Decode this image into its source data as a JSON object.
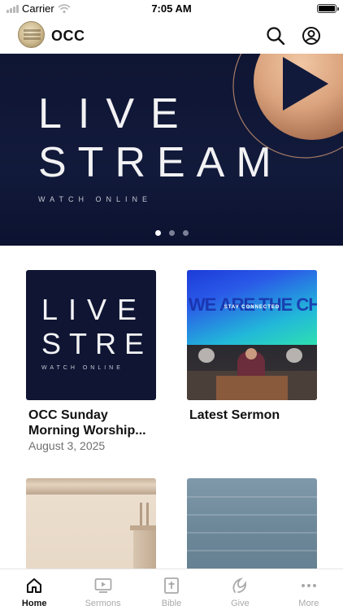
{
  "status_bar": {
    "carrier": "Carrier",
    "time": "7:05 AM"
  },
  "header": {
    "title": "OCC",
    "search_icon": "search-icon",
    "account_icon": "account-icon"
  },
  "hero": {
    "line1": "LIVE",
    "line2": "STREAM",
    "subtitle": "WATCH ONLINE",
    "slide_count": 3,
    "active_slide": 1
  },
  "cards": [
    {
      "thumb_line1": "LIVE",
      "thumb_line2": "STRE",
      "thumb_sub": "WATCH ONLINE",
      "title": "OCC Sunday Morning Worship...",
      "date": "August 3, 2025"
    },
    {
      "thumb_big": "WE ARE THE CHURCH",
      "thumb_small": "STAY CONNECTED",
      "title": "Latest Sermon",
      "date": ""
    },
    {
      "title": "",
      "date": ""
    },
    {
      "title": "",
      "date": ""
    }
  ],
  "tabs": [
    {
      "label": "Home",
      "icon": "home-icon",
      "active": true
    },
    {
      "label": "Sermons",
      "icon": "video-icon",
      "active": false
    },
    {
      "label": "Bible",
      "icon": "bible-icon",
      "active": false
    },
    {
      "label": "Give",
      "icon": "give-icon",
      "active": false
    },
    {
      "label": "More",
      "icon": "more-icon",
      "active": false
    }
  ],
  "colors": {
    "hero_bg": "#0f1533",
    "active_tab": "#111111",
    "inactive_tab": "#a9a9a9"
  }
}
